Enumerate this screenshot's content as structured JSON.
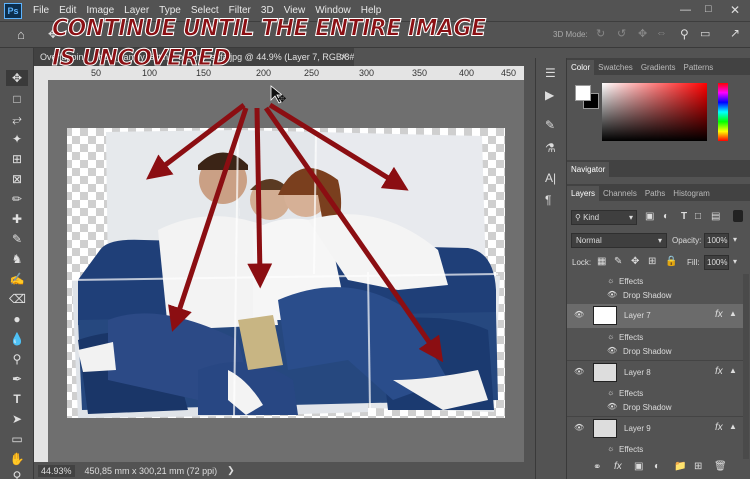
{
  "menu": [
    "File",
    "Edit",
    "Image",
    "Layer",
    "Type",
    "Select",
    "Filter",
    "3D",
    "View",
    "Window",
    "Help"
  ],
  "options": {
    "mode_label": "3D Mode:"
  },
  "doc_tab": {
    "title": "Overlapping_photo_family_sitting_on_the_sofa.jpg @ 44.9% (Layer 7, RGB/8#) *"
  },
  "ruler": {
    "ticks": [
      "50",
      "100",
      "150",
      "200",
      "250",
      "300",
      "350",
      "400",
      "450"
    ]
  },
  "annotation": {
    "line1": "CONTINUE UNTIL THE ENTIRE IMAGE",
    "line2": "IS UNCOVERED"
  },
  "status": {
    "zoom": "44.93%",
    "doc_size": "450,85 mm x 300,21 mm (72 ppi)"
  },
  "color_panel": {
    "tabs": [
      "Color",
      "Swatches",
      "Gradients",
      "Patterns"
    ]
  },
  "navigator": {
    "title": "Navigator"
  },
  "layers_panel": {
    "tabs": [
      "Layers",
      "Channels",
      "Paths",
      "Histogram"
    ],
    "filter_kind": "Kind",
    "blend_mode": "Normal",
    "opacity_label": "Opacity:",
    "opacity": "100%",
    "lock_label": "Lock:",
    "fill_label": "Fill:",
    "fill": "100%",
    "effects_label": "Effects",
    "drop_shadow_label": "Drop Shadow",
    "layers": [
      {
        "name": "Layer 7"
      },
      {
        "name": "Layer 8"
      },
      {
        "name": "Layer 9"
      }
    ],
    "fx_label": "fx"
  },
  "colors": {
    "arrow": "#8b0e12",
    "annotation_text": "#8b1014",
    "annotation_outline": "#ffffff"
  }
}
